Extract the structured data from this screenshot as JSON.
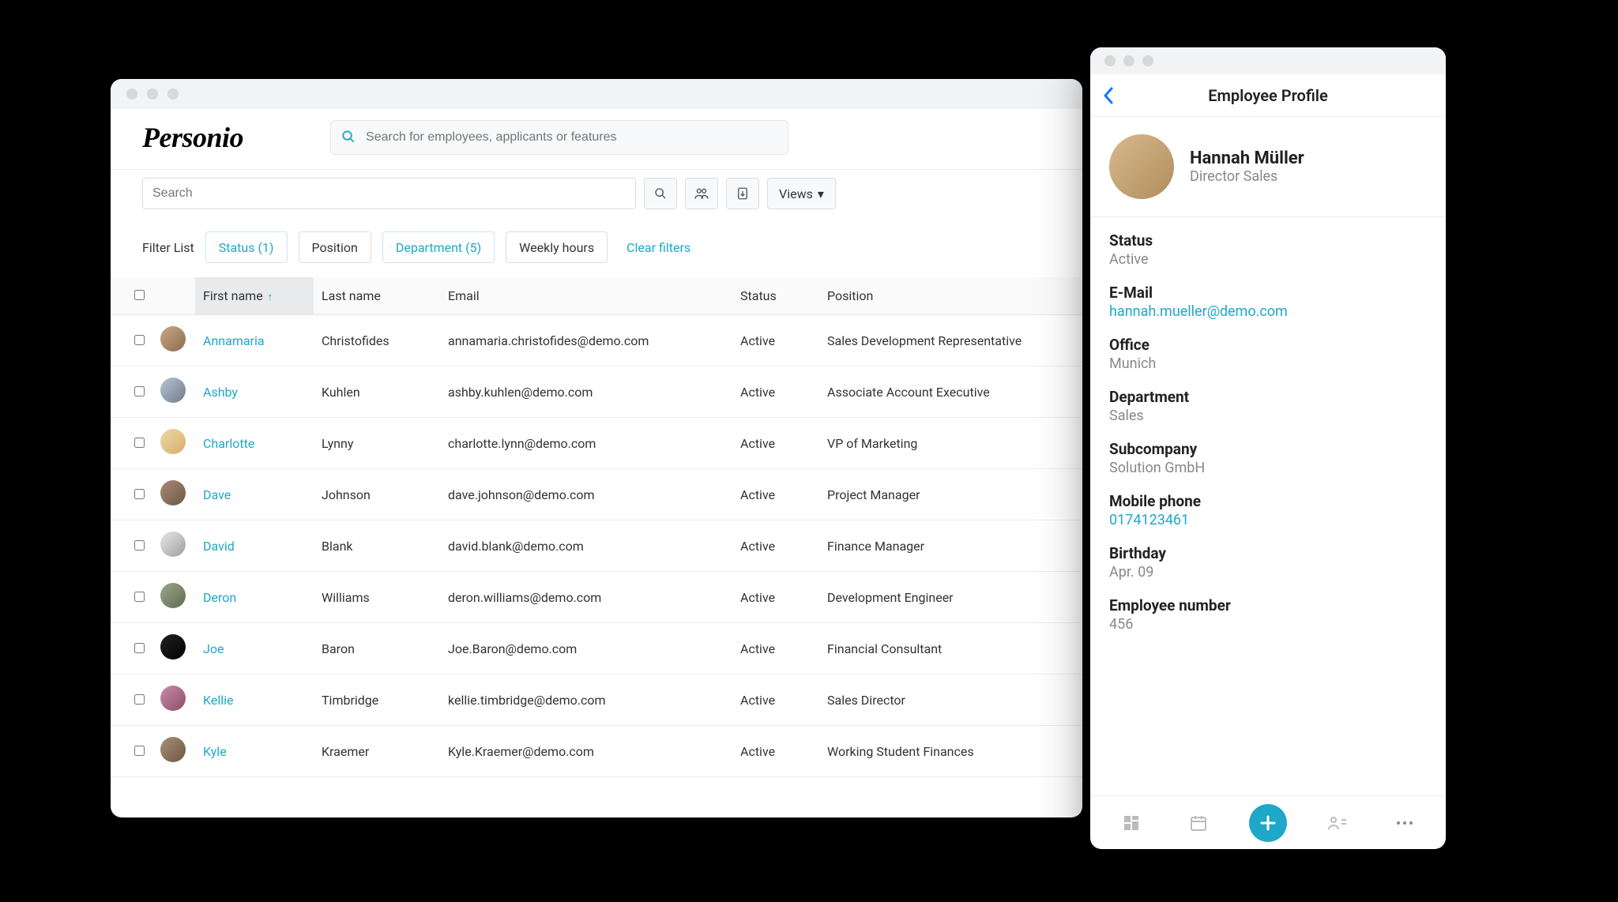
{
  "app": {
    "logo": "Personio",
    "global_search_placeholder": "Search for employees, applicants or features",
    "list_search_placeholder": "Search",
    "views_label": "Views"
  },
  "filters": {
    "label": "Filter List",
    "chips": [
      {
        "label": "Status (1)",
        "active": true
      },
      {
        "label": "Position",
        "active": false
      },
      {
        "label": "Department (5)",
        "active": true
      },
      {
        "label": "Weekly hours",
        "active": false
      }
    ],
    "clear_label": "Clear filters"
  },
  "table": {
    "columns": [
      "First name",
      "Last name",
      "Email",
      "Status",
      "Position"
    ],
    "sorted_column": "First name",
    "rows": [
      {
        "first": "Annamaria",
        "last": "Christofides",
        "email": "annamaria.christofides@demo.com",
        "status": "Active",
        "position": "Sales Development Representative"
      },
      {
        "first": "Ashby",
        "last": "Kuhlen",
        "email": "ashby.kuhlen@demo.com",
        "status": "Active",
        "position": "Associate Account Executive"
      },
      {
        "first": "Charlotte",
        "last": "Lynny",
        "email": "charlotte.lynn@demo.com",
        "status": "Active",
        "position": "VP of Marketing"
      },
      {
        "first": "Dave",
        "last": "Johnson",
        "email": "dave.johnson@demo.com",
        "status": "Active",
        "position": "Project Manager"
      },
      {
        "first": "David",
        "last": "Blank",
        "email": "david.blank@demo.com",
        "status": "Active",
        "position": "Finance Manager"
      },
      {
        "first": "Deron",
        "last": "Williams",
        "email": "deron.williams@demo.com",
        "status": "Active",
        "position": "Development Engineer"
      },
      {
        "first": "Joe",
        "last": "Baron",
        "email": "Joe.Baron@demo.com",
        "status": "Active",
        "position": "Financial Consultant"
      },
      {
        "first": "Kellie",
        "last": "Timbridge",
        "email": "kellie.timbridge@demo.com",
        "status": "Active",
        "position": "Sales Director"
      },
      {
        "first": "Kyle",
        "last": "Kraemer",
        "email": "Kyle.Kraemer@demo.com",
        "status": "Active",
        "position": "Working Student Finances"
      }
    ]
  },
  "profile": {
    "title": "Employee Profile",
    "name": "Hannah Müller",
    "role": "Director Sales",
    "fields": [
      {
        "label": "Status",
        "value": "Active",
        "link": false
      },
      {
        "label": "E-Mail",
        "value": "hannah.mueller@demo.com",
        "link": true
      },
      {
        "label": "Office",
        "value": "Munich",
        "link": false
      },
      {
        "label": "Department",
        "value": "Sales",
        "link": false
      },
      {
        "label": "Subcompany",
        "value": "Solution GmbH",
        "link": false
      },
      {
        "label": "Mobile phone",
        "value": "0174123461",
        "link": true
      },
      {
        "label": "Birthday",
        "value": "Apr. 09",
        "link": false
      },
      {
        "label": "Employee number",
        "value": "456",
        "link": false
      }
    ]
  },
  "colors": {
    "accent": "#1fa7c9"
  }
}
